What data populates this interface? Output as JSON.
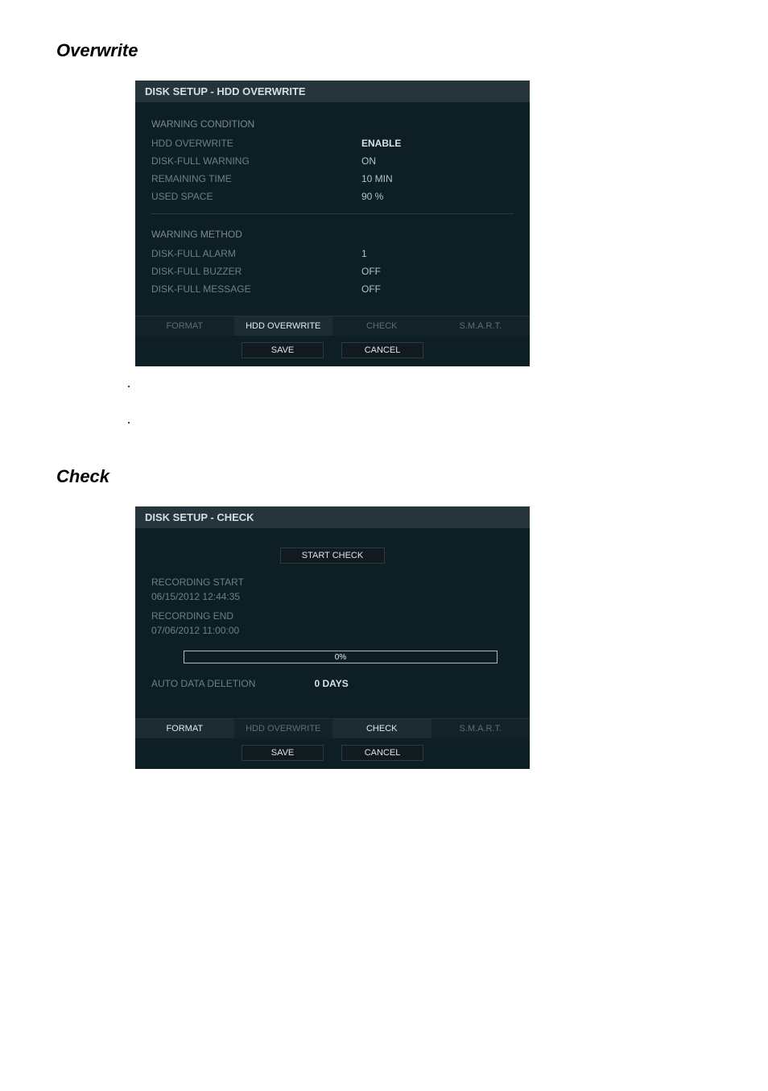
{
  "headings": {
    "overwrite": "Overwrite",
    "check": "Check"
  },
  "panel1": {
    "title": "DISK SETUP - HDD OVERWRITE",
    "section1": "WARNING CONDITION",
    "rows1": [
      {
        "label": "HDD OVERWRITE",
        "value": "ENABLE",
        "highlight": true
      },
      {
        "label": "DISK-FULL WARNING",
        "value": "ON"
      },
      {
        "label": "REMAINING TIME",
        "value": "10 MIN"
      },
      {
        "label": "USED SPACE",
        "value": "90 %"
      }
    ],
    "section2": "WARNING METHOD",
    "rows2": [
      {
        "label": "DISK-FULL ALARM",
        "value": "1"
      },
      {
        "label": "DISK-FULL BUZZER",
        "value": "OFF"
      },
      {
        "label": "DISK-FULL MESSAGE",
        "value": "OFF"
      }
    ],
    "tabs": {
      "format": "FORMAT",
      "hdd_overwrite": "HDD OVERWRITE",
      "check": "CHECK",
      "smart": "S.M.A.R.T."
    },
    "buttons": {
      "save": "SAVE",
      "cancel": "CANCEL"
    }
  },
  "panel2": {
    "title": "DISK SETUP - CHECK",
    "start_check": "START CHECK",
    "rec_start_label": "RECORDING START",
    "rec_start_value": "06/15/2012 12:44:35",
    "rec_end_label": "RECORDING END",
    "rec_end_value": "07/06/2012 11:00:00",
    "progress_pct": "0%",
    "auto_delete_label": "AUTO DATA DELETION",
    "auto_delete_value": "0 DAYS",
    "tabs": {
      "format": "FORMAT",
      "hdd_overwrite": "HDD OVERWRITE",
      "check": "CHECK",
      "smart": "S.M.A.R.T."
    },
    "buttons": {
      "save": "SAVE",
      "cancel": "CANCEL"
    }
  }
}
